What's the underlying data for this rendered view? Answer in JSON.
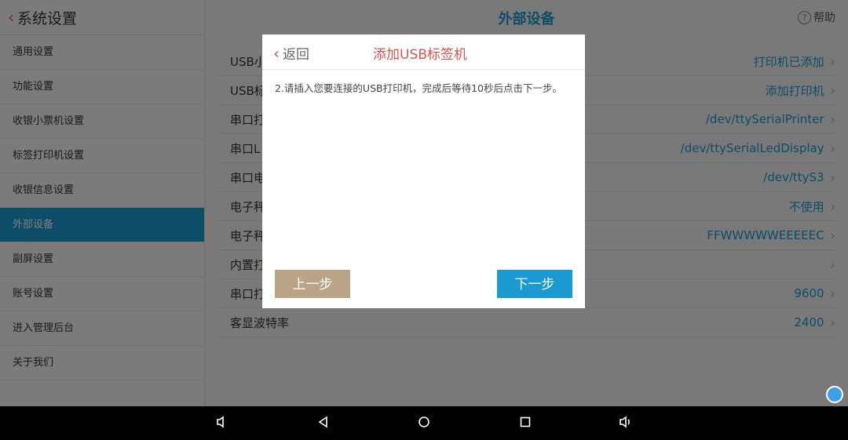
{
  "sidebar": {
    "title": "系统设置",
    "items": [
      {
        "label": "通用设置"
      },
      {
        "label": "功能设置"
      },
      {
        "label": "收银小票机设置"
      },
      {
        "label": "标签打印机设置"
      },
      {
        "label": "收银信息设置"
      },
      {
        "label": "外部设备"
      },
      {
        "label": "副屏设置"
      },
      {
        "label": "账号设置"
      },
      {
        "label": "进入管理后台"
      },
      {
        "label": "关于我们"
      }
    ],
    "active_index": 5
  },
  "main": {
    "title": "外部设备",
    "help": "帮助",
    "rows": [
      {
        "label": "USB小",
        "value": "打印机已添加"
      },
      {
        "label": "USB标",
        "value": "添加打印机"
      },
      {
        "label": "串口打",
        "value": "/dev/ttySerialPrinter"
      },
      {
        "label": "串口L",
        "value": "/dev/ttySerialLedDisplay"
      },
      {
        "label": "串口电",
        "value": "/dev/ttyS3"
      },
      {
        "label": "电子秤",
        "value": "不使用"
      },
      {
        "label": "电子秤",
        "value": "FFWWWWWEEEEEC"
      },
      {
        "label": "内置打",
        "value": ""
      },
      {
        "label": "串口打",
        "value": "9600"
      },
      {
        "label": "客显波特率",
        "value": "2400"
      }
    ]
  },
  "dialog": {
    "back": "返回",
    "title": "添加USB标签机",
    "message": "2.请插入您要连接的USB打印机，完成后等待10秒后点击下一步。",
    "prev_label": "上一步",
    "next_label": "下一步"
  },
  "navbar": {
    "icons": [
      "volume-down-icon",
      "back-icon",
      "home-icon",
      "recents-icon",
      "volume-up-icon"
    ]
  },
  "colors": {
    "accent": "#1b9ad1",
    "red": "#d9534f",
    "prev_button": "#b9a487"
  }
}
